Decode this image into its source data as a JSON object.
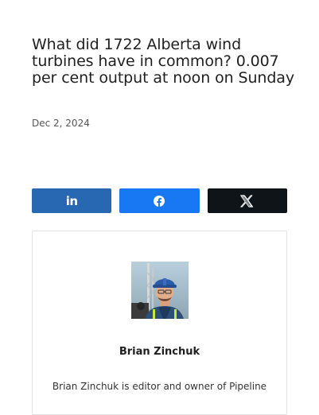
{
  "article": {
    "title": "What did 1722 Alberta wind turbines have in common? 0.007 per cent output at noon on Sunday",
    "date": "Dec 2, 2024"
  },
  "share": {
    "linkedin_label": "in",
    "colors": {
      "linkedin": "#2867b2",
      "facebook": "#1877f2",
      "x": "#0f1419"
    },
    "icons": [
      "linkedin-icon",
      "facebook-icon",
      "x-icon"
    ]
  },
  "author": {
    "name": "Brian Zinchuk",
    "bio": "Brian Zinchuk is editor and owner of Pipeline"
  }
}
